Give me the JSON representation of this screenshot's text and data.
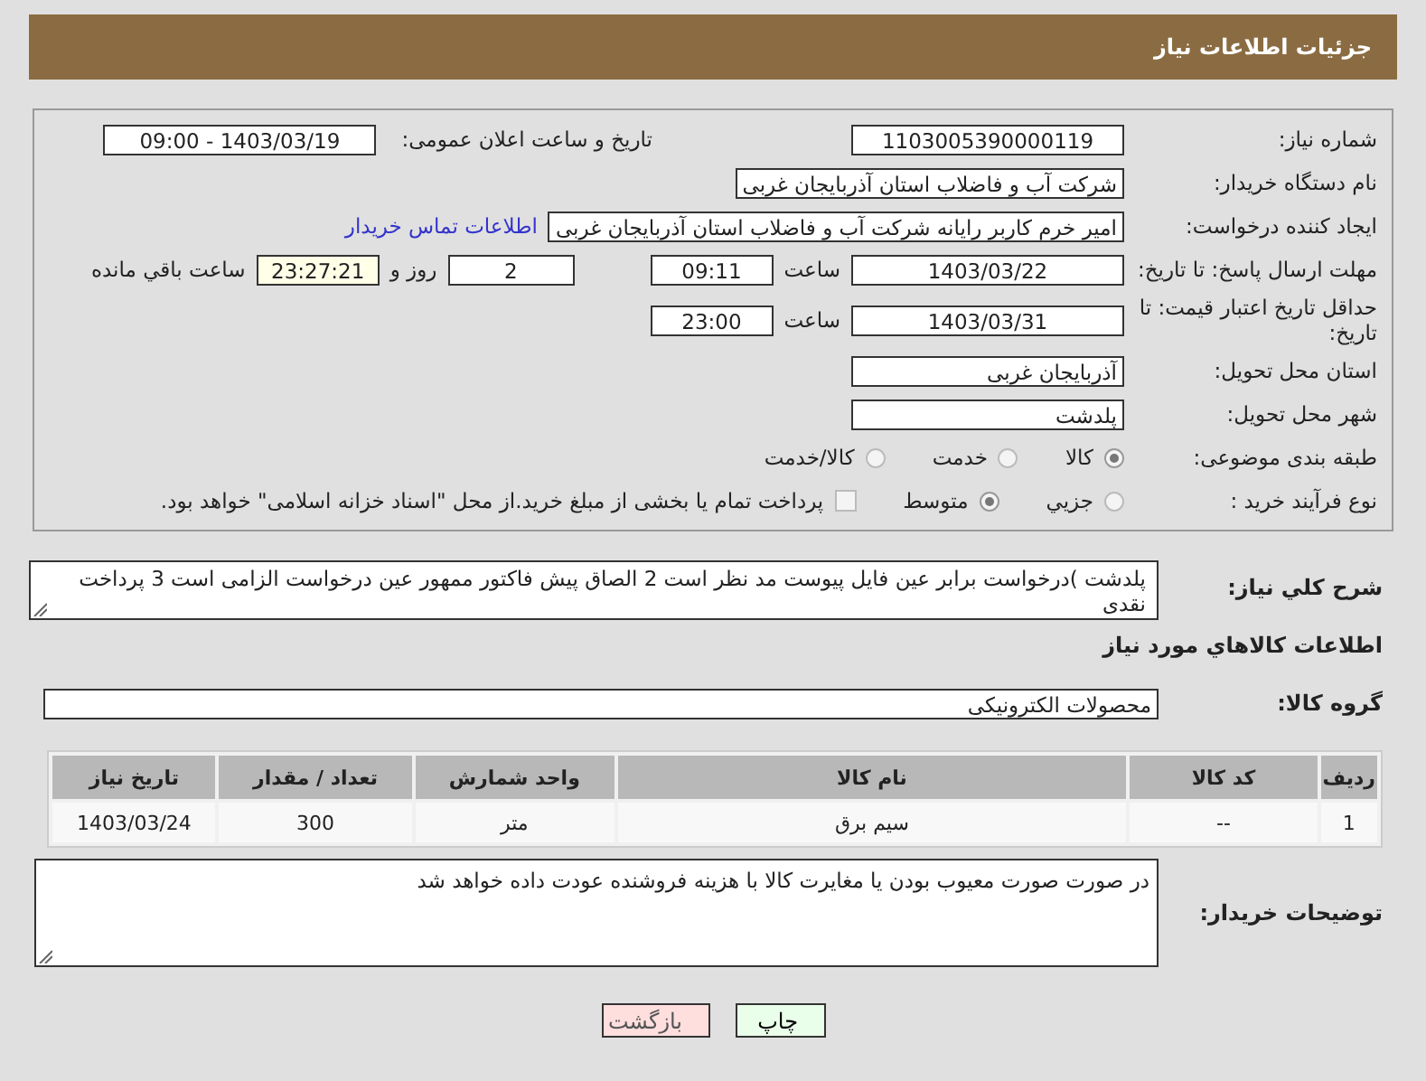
{
  "header": {
    "title": "جزئیات اطلاعات نیاز"
  },
  "need_number": {
    "label": "شماره نیاز:",
    "value": "1103005390000119"
  },
  "announce": {
    "label": "تاریخ و ساعت اعلان عمومی:",
    "value": "1403/03/19 - 09:00"
  },
  "buyer_org": {
    "label": "نام دستگاه خریدار:",
    "value": "شرکت آب و فاضلاب استان آذربایجان غربی"
  },
  "requester": {
    "label": "ایجاد کننده درخواست:",
    "value": "امیر خرم کاربر رایانه شرکت آب و فاضلاب استان آذربایجان غربی",
    "link": "اطلاعات تماس خریدار"
  },
  "reply_deadline": {
    "label": "مهلت ارسال پاسخ: تا تاریخ:",
    "date": "1403/03/22",
    "time_label": "ساعت",
    "time": "09:11",
    "days": "2",
    "days_label": "روز و",
    "remaining": "23:27:21",
    "remaining_label": "ساعت باقي مانده"
  },
  "price_validity": {
    "label": "حداقل تاریخ اعتبار قیمت: تا تاریخ:",
    "date": "1403/03/31",
    "time_label": "ساعت",
    "time": "23:00"
  },
  "province": {
    "label": "استان محل تحویل:",
    "value": "آذربایجان غربی"
  },
  "city": {
    "label": "شهر محل تحویل:",
    "value": "پلدشت"
  },
  "category": {
    "label": "طبقه بندی موضوعی:",
    "options": [
      {
        "label": "کالا",
        "selected": true
      },
      {
        "label": "خدمت",
        "selected": false
      },
      {
        "label": "کالا/خدمت",
        "selected": false
      }
    ]
  },
  "purchase_type": {
    "label": "نوع فرآیند خرید :",
    "options": [
      {
        "label": "جزیي",
        "selected": false
      },
      {
        "label": "متوسط",
        "selected": true
      }
    ],
    "treasury": {
      "label": "پرداخت تمام یا بخشی از مبلغ خرید.از محل \"اسناد خزانه اسلامی\" خواهد بود.",
      "checked": false
    }
  },
  "description": {
    "label": "شرح کلي نياز:",
    "value": "پلدشت )درخواست برابر عین فایل پیوست مد نظر است 2 الصاق پیش فاکتور ممهور عین درخواست الزامی است 3 پرداخت نقدی"
  },
  "goods_heading": "اطلاعات کالاهاي مورد نياز",
  "goods_group": {
    "label": "گروه کالا:",
    "value": "محصولات الکترونیکی"
  },
  "table": {
    "columns": [
      "ردیف",
      "کد کالا",
      "نام کالا",
      "واحد شمارش",
      "تعداد / مقدار",
      "تاریخ نیاز"
    ],
    "rows": [
      [
        "1",
        "--",
        "سیم برق",
        "متر",
        "300",
        "1403/03/24"
      ]
    ]
  },
  "buyer_notes": {
    "label": "توضیحات خریدار:",
    "value": "در صورت صورت معیوب بودن یا مغایرت کالا با هزینه فروشنده عودت داده خواهد شد"
  },
  "buttons": [
    {
      "label": "چاپ",
      "kind": "print"
    },
    {
      "label": "بازگشت",
      "kind": "back"
    }
  ]
}
